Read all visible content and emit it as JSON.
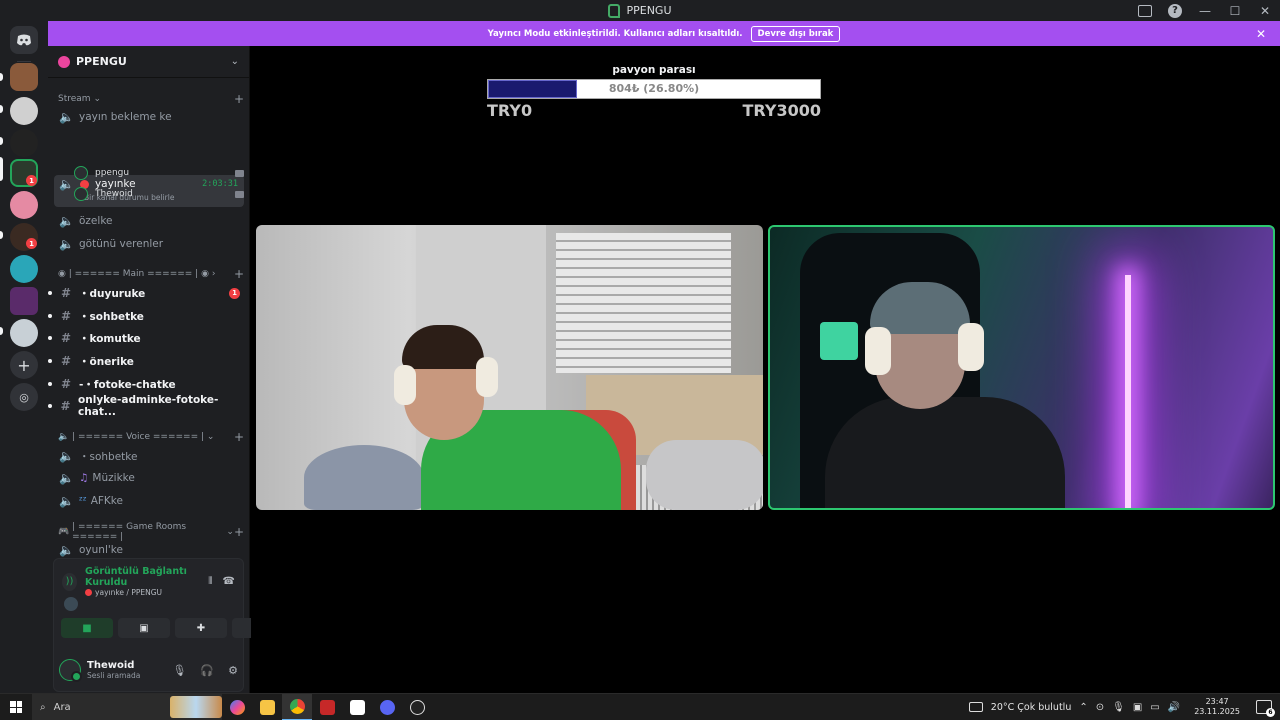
{
  "window": {
    "title": "PPENGU"
  },
  "notice": {
    "text": "Yayıncı Modu etkinleştirildi. Kullanıcı adları kısaltıldı.",
    "button": "Devre dışı bırak"
  },
  "server": {
    "name": "PPENGU"
  },
  "rail": {
    "badges": [
      "1",
      "1"
    ]
  },
  "categories": {
    "stream": "Stream",
    "main": "| ====== Main ====== |",
    "voice": "| ====== Voice ====== |",
    "game": "| ====== Game Rooms ====== |"
  },
  "channels": {
    "stream": [
      "yayın bekleme ke",
      "özelke",
      "götünü verenler"
    ],
    "active": {
      "name": "yayınke",
      "timer": "2:03:31",
      "status": "Bir kanal durumu belirle"
    },
    "voice_users": [
      "ppengu",
      "Thewoid"
    ],
    "text": [
      {
        "name": "・duyuruke",
        "badge": "1"
      },
      {
        "name": "・sohbetke"
      },
      {
        "name": "・komutke"
      },
      {
        "name": "・önerike"
      },
      {
        "name": "-・fotoke-chatke"
      },
      {
        "name": "onlyke-adminke-fotoke-chat..."
      }
    ],
    "voice": [
      "・sohbetke",
      "Müzikke",
      "AFKke"
    ],
    "game": [
      "oyunl'ke"
    ]
  },
  "voice_panel": {
    "status": "Görüntülü Bağlantı Kuruldu",
    "location": "yayınke / PPENGU"
  },
  "user": {
    "name": "Thewoid",
    "status": "Sesli aramada"
  },
  "donation": {
    "title": "pavyon parası",
    "amount_text": "804₺ (26.80%)",
    "progress": 0.268,
    "min": "TRY0",
    "max": "TRY3000"
  },
  "taskbar": {
    "search_placeholder": "Ara",
    "weather": "20°C  Çok bulutlu",
    "time": "23:47",
    "date": "23.11.2025",
    "notif_count": "6"
  },
  "colors": {
    "accent": "#a44ff0",
    "online": "#23a55a",
    "alert": "#f23f43",
    "donation_fill": "#1a1a6e"
  }
}
